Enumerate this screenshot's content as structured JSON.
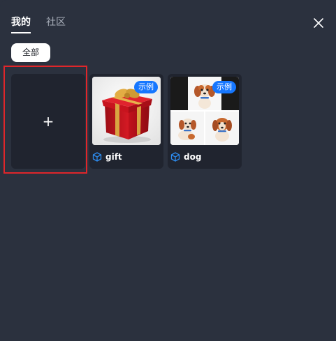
{
  "tabs": [
    {
      "label": "我的",
      "active": true
    },
    {
      "label": "社区",
      "active": false
    }
  ],
  "filter": {
    "label": "全部"
  },
  "add_card": {
    "symbol": "+"
  },
  "cards": [
    {
      "name": "gift",
      "badge": "示例",
      "thumb_icon": "gift-box-image"
    },
    {
      "name": "dog",
      "badge": "示例",
      "thumb_icon": "puppy-image-grid"
    }
  ],
  "colors": {
    "panel_bg": "#2b313e",
    "card_bg": "#20242f",
    "badge_bg": "#1677ff",
    "highlight": "#e0262a",
    "icon_blue": "#2d8cf0"
  },
  "icons": {
    "close": "close-icon",
    "card_type": "cube-icon"
  }
}
